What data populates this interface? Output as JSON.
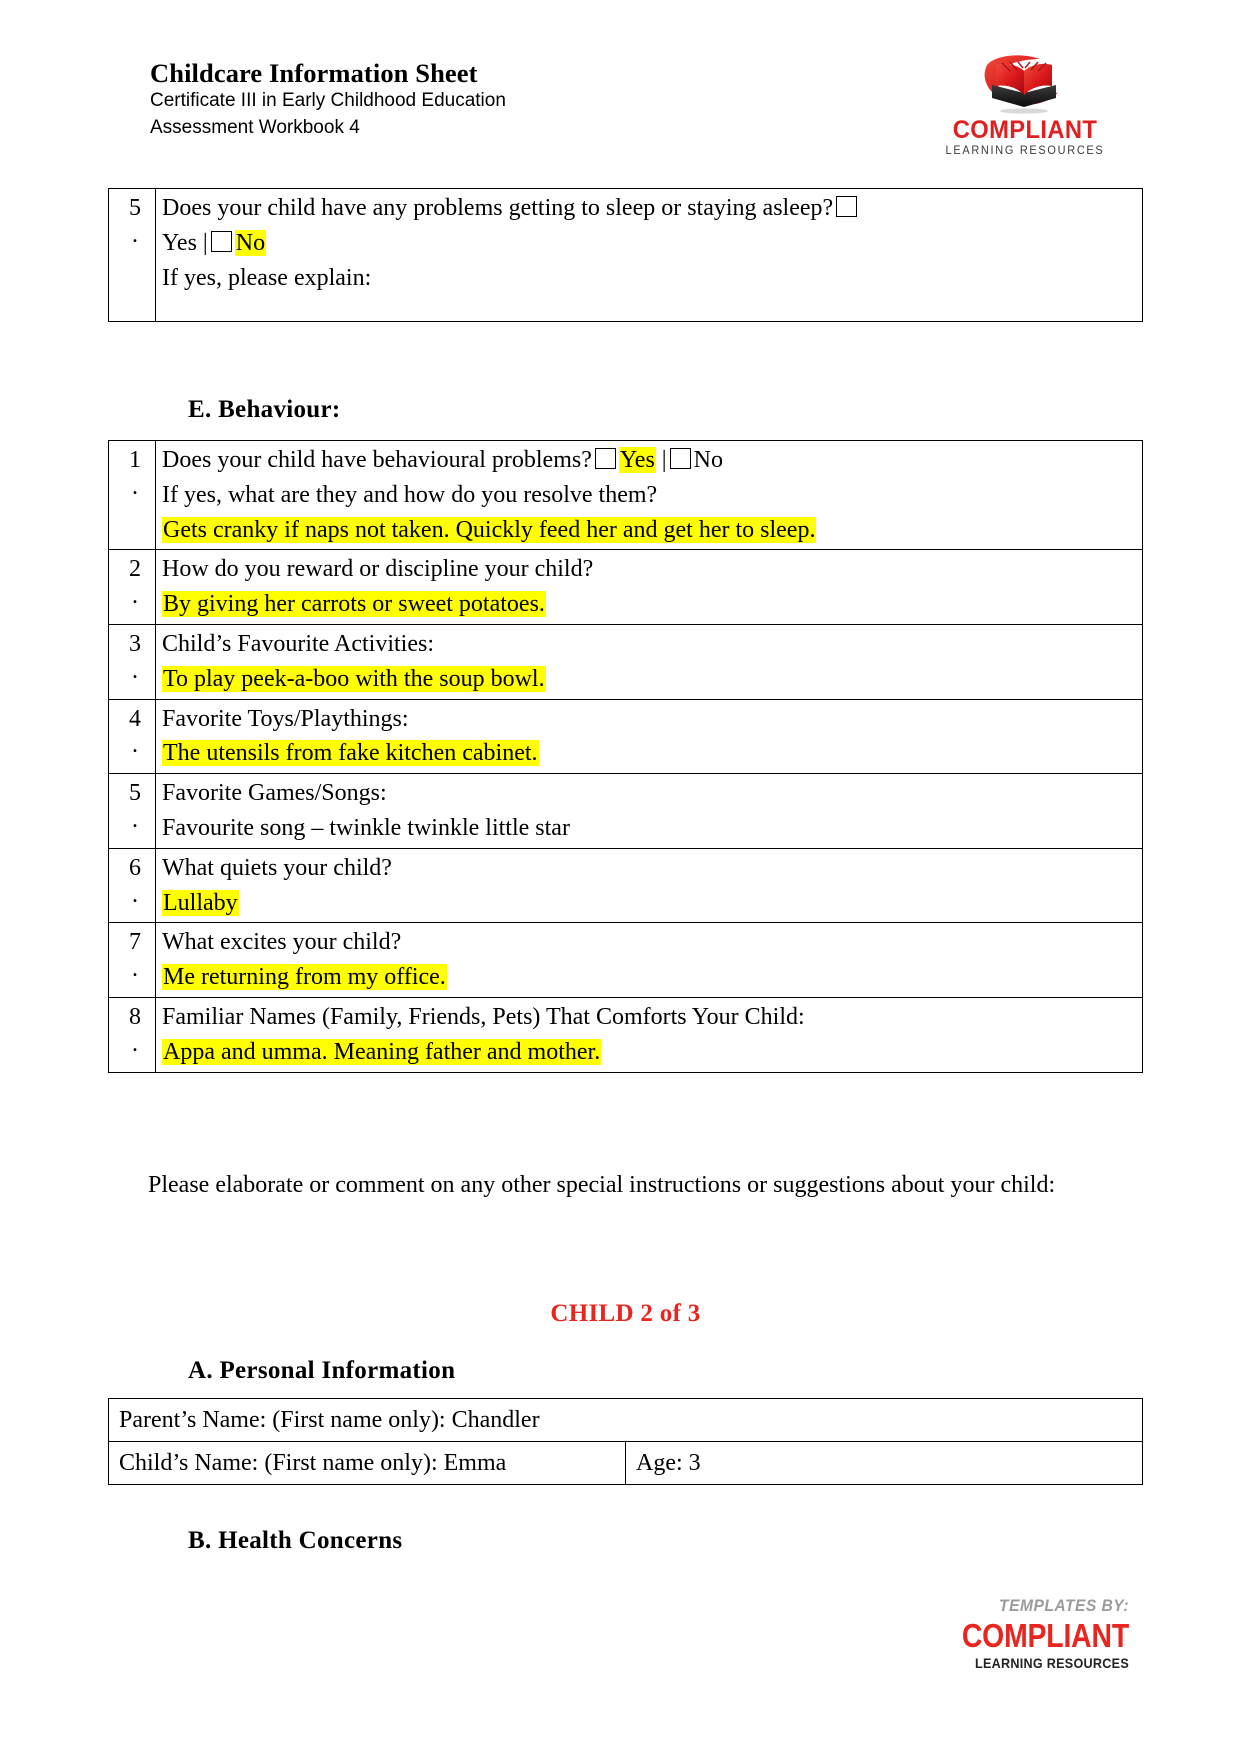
{
  "header": {
    "title": "Childcare Information Sheet",
    "subtitle_line1": "Certificate III in Early Childhood Education",
    "subtitle_line2": "Assessment Workbook 4",
    "logo": {
      "word": "COMPLIANT",
      "tagline": "LEARNING RESOURCES",
      "icon": "open-book-swoosh-logo",
      "brand_red": "#e02020"
    }
  },
  "sleep_question": {
    "number": "5",
    "dot": ".",
    "line1": "Does your child have any problems getting to sleep or staying asleep?",
    "yes_label": "Yes",
    "separator": "|",
    "no_label": "No",
    "no_highlighted": true,
    "line3": "If yes, please explain:"
  },
  "behaviour_section": {
    "heading": "E. Behaviour:",
    "rows": [
      {
        "number": "1",
        "dot": ".",
        "question": "Does your child have behavioural problems?",
        "yes_label": "Yes",
        "separator": "|",
        "no_label": "No",
        "yes_highlighted": true,
        "followup": "If yes, what are they and how do you resolve them?",
        "answer": "Gets cranky if naps not taken. Quickly feed her and get her to sleep.",
        "answer_highlighted": true
      },
      {
        "number": "2",
        "dot": ".",
        "question": "How do you reward or discipline your child?",
        "answer": "By giving her carrots or sweet potatoes.",
        "answer_highlighted": true
      },
      {
        "number": "3",
        "dot": ".",
        "question": "Child’s Favourite Activities:",
        "answer": "To play peek-a-boo with the soup bowl.",
        "answer_highlighted": true
      },
      {
        "number": "4",
        "dot": ".",
        "question": "Favorite Toys/Playthings:",
        "answer": "The utensils from fake kitchen cabinet.",
        "answer_highlighted": true
      },
      {
        "number": "5",
        "dot": ".",
        "question": "Favorite Games/Songs:",
        "answer": "Favourite song – twinkle twinkle little star",
        "answer_highlighted": false
      },
      {
        "number": "6",
        "dot": ".",
        "question": "What quiets your child?",
        "answer": "Lullaby",
        "answer_highlighted": true
      },
      {
        "number": "7",
        "dot": ".",
        "question": "What excites your child?",
        "answer": "Me returning from my office.",
        "answer_highlighted": true
      },
      {
        "number": "8",
        "dot": ".",
        "question": "Familiar Names (Family, Friends, Pets) That Comforts Your Child:",
        "answer": "Appa and umma.  Meaning father and mother.",
        "answer_highlighted": true
      }
    ]
  },
  "elaborate_paragraph": "Please elaborate or comment on any other special instructions or suggestions about your child:",
  "child_banner": {
    "text": "CHILD 2 of 3",
    "color": "#e8251f"
  },
  "personal_information": {
    "heading": "A. Personal Information",
    "parent_row": "Parent’s Name: (First name only): Chandler",
    "child_row": "Child’s Name: (First name only): Emma",
    "age_row": "Age:  3"
  },
  "health_concerns": {
    "heading": "B. Health Concerns"
  },
  "footer": {
    "templates_by": "TEMPLATES BY:",
    "word": "COMPLIANT",
    "tagline": "LEARNING RESOURCES"
  }
}
